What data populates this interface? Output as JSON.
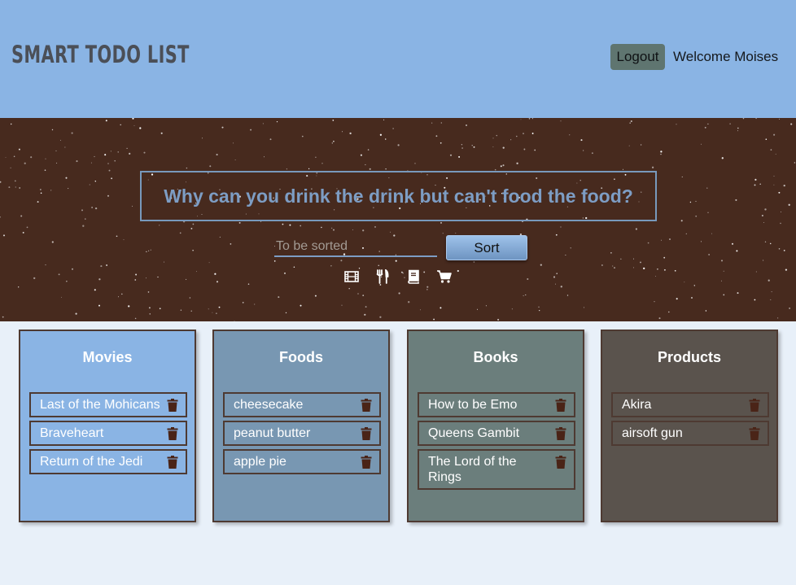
{
  "header": {
    "logo": "SMART TODO LIST",
    "logout_label": "Logout",
    "welcome_text": "Welcome Moises",
    "background": "#8ab4e4"
  },
  "hero": {
    "question": "Why can you drink the drink but can't food the food?",
    "input_placeholder": "To be sorted",
    "input_value": "",
    "sort_label": "Sort",
    "category_icons": [
      "film-icon",
      "utensils-icon",
      "book-icon",
      "cart-icon"
    ],
    "background": "#472a1e"
  },
  "categories": [
    {
      "title": "Movies",
      "color": "#8ab4e4",
      "items": [
        "Last of the Mohicans",
        "Braveheart",
        "Return of the Jedi"
      ]
    },
    {
      "title": "Foods",
      "color": "#7897b2",
      "items": [
        "cheesecake",
        "peanut butter",
        "apple pie"
      ]
    },
    {
      "title": "Books",
      "color": "#6b7e7c",
      "items": [
        "How to be Emo",
        "Queens Gambit",
        "The Lord of the Rings"
      ]
    },
    {
      "title": "Products",
      "color": "#5a534d",
      "items": [
        "Akira",
        "airsoft gun"
      ]
    }
  ],
  "trash_icon": "trash-icon",
  "trash_color": "#4a2417"
}
